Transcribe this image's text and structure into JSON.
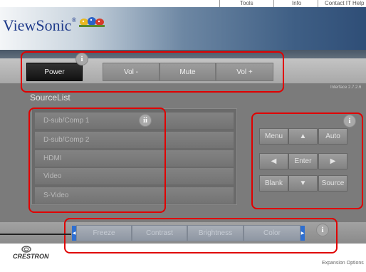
{
  "topnav": {
    "tools": "Tools",
    "info": "Info",
    "contact": "Contact IT Help"
  },
  "header": {
    "logo_text": "ViewSonic",
    "trademark": "®"
  },
  "version": "Interface 2.7.2.6",
  "buttons": {
    "power": "Power",
    "vol_minus": "Vol -",
    "mute": "Mute",
    "vol_plus": "Vol +"
  },
  "source_list": {
    "title": "SourceList",
    "items": [
      "D-sub/Comp 1",
      "D-sub/Comp 2",
      "HDMI",
      "Video",
      "S-Video"
    ]
  },
  "controls": {
    "menu": "Menu",
    "up": "▲",
    "auto": "Auto",
    "left": "◀",
    "enter": "Enter",
    "right": "▶",
    "blank": "Blank",
    "down": "▼",
    "source": "Source"
  },
  "bottom_bar": {
    "items": [
      "Freeze",
      "Contrast",
      "Brightness",
      "Color"
    ]
  },
  "footer": {
    "brand": "CRESTRON",
    "expansion": "Expansion Options"
  },
  "annotations": {
    "badge_i": "i",
    "badge_ii": "ii"
  },
  "colors": {
    "annotation": "#e00000",
    "accent_blue": "#2f6fd0",
    "logo_blue": "#1e3a8a"
  }
}
